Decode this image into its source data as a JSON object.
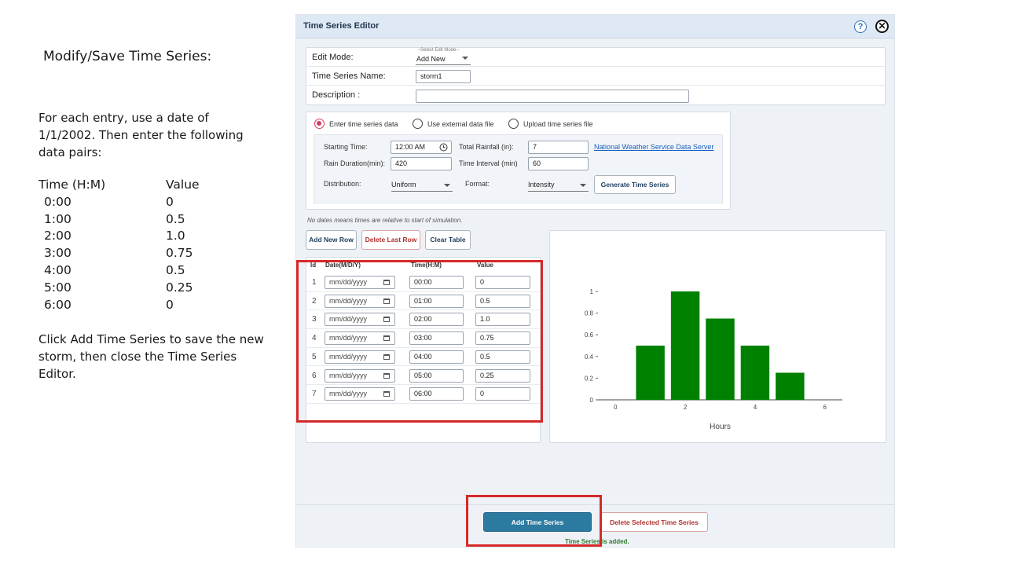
{
  "instructions": {
    "heading": "Modify/Save Time Series:",
    "paragraph1": "For each entry, use a date of 1/1/2002.  Then enter the following data pairs:",
    "table_headers": [
      "Time (H:M)",
      "Value"
    ],
    "pairs": [
      {
        "time": "0:00",
        "value": "0"
      },
      {
        "time": "1:00",
        "value": "0.5"
      },
      {
        "time": "2:00",
        "value": "1.0"
      },
      {
        "time": "3:00",
        "value": "0.75"
      },
      {
        "time": "4:00",
        "value": "0.5"
      },
      {
        "time": "5:00",
        "value": "0.25"
      },
      {
        "time": "6:00",
        "value": "0"
      }
    ],
    "paragraph2": "Click Add Time Series to save the new storm, then close the Time Series Editor."
  },
  "editor": {
    "title": "Time Series Editor",
    "help_glyph": "?",
    "close_glyph": "✕",
    "form": {
      "edit_mode_label": "Edit Mode:",
      "edit_mode_hint": "--Select Edit Mode--",
      "edit_mode_value": "Add New",
      "name_label": "Time Series Name:",
      "name_value": "storm1",
      "description_label": "Description :",
      "description_value": ""
    },
    "sources": {
      "enter": "Enter time series data",
      "external": "Use external data file",
      "upload": "Upload time series file",
      "selected": "enter"
    },
    "params": {
      "start_label": "Starting Time:",
      "start_value": "12:00 AM",
      "total_label": "Total Rainfall (in):",
      "total_value": "7",
      "nws_link": "National Weather Service Data Server",
      "duration_label": "Rain Duration(min):",
      "duration_value": "420",
      "interval_label": "Time Interval (min)",
      "interval_value": "60",
      "distribution_label": "Distribution:",
      "distribution_value": "Uniform",
      "format_label": "Format:",
      "format_value": "Intensity",
      "generate_button": "Generate Time Series"
    },
    "note": "No dates means times are relative to start of simulation.",
    "table_buttons": {
      "add_row": "Add New Row",
      "delete_row": "Delete Last Row",
      "clear": "Clear Table"
    },
    "table": {
      "headers": {
        "id": "Id",
        "date": "Date(M/D/Y)",
        "time": "Time(H:M)",
        "value": "Value"
      },
      "date_placeholder": "mm/dd/yyyy",
      "rows": [
        {
          "id": "1",
          "time": "00:00",
          "value": "0"
        },
        {
          "id": "2",
          "time": "01:00",
          "value": "0.5"
        },
        {
          "id": "3",
          "time": "02:00",
          "value": "1.0"
        },
        {
          "id": "4",
          "time": "03:00",
          "value": "0.75"
        },
        {
          "id": "5",
          "time": "04:00",
          "value": "0.5"
        },
        {
          "id": "6",
          "time": "05:00",
          "value": "0.25"
        },
        {
          "id": "7",
          "time": "06:00",
          "value": "0"
        }
      ]
    },
    "footer": {
      "add_button": "Add Time Series",
      "delete_button": "Delete Selected Time Series",
      "status": "Time Series is added."
    }
  },
  "colors": {
    "accent": "#2d7aa0",
    "bar": "#008000",
    "highlight": "#d42a2a",
    "radio_selected": "#d63b63"
  },
  "chart_data": {
    "type": "bar",
    "x": [
      1,
      2,
      3,
      4,
      5
    ],
    "values": [
      0.5,
      1.0,
      0.75,
      0.5,
      0.25
    ],
    "xlabel": "Hours",
    "ylabel": "",
    "xticks": [
      "0",
      "2",
      "4",
      "6"
    ],
    "yticks": [
      "0",
      "0.2",
      "0.4",
      "0.6",
      "0.8",
      "1"
    ],
    "xlim": [
      -0.5,
      6.5
    ],
    "ylim": [
      0,
      1.0
    ],
    "grid": false,
    "bar_color": "#008000"
  }
}
